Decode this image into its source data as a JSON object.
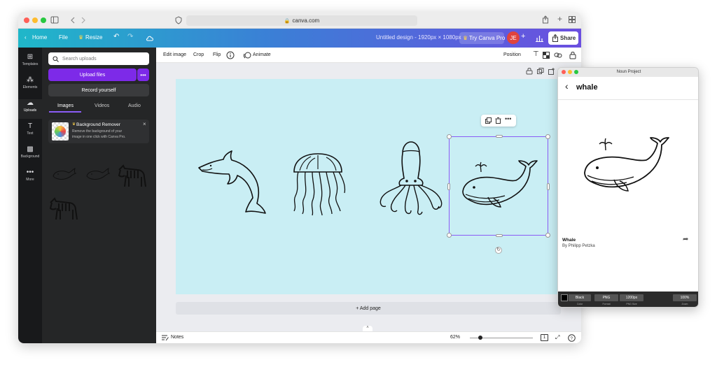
{
  "browser": {
    "address": "canva.com"
  },
  "canva_header": {
    "home": "Home",
    "file": "File",
    "resize": "Resize",
    "design_title": "Untitled design - 1920px × 1080px",
    "try_pro": "Try Canva Pro",
    "avatar": "JE",
    "share": "Share"
  },
  "rail": {
    "items": [
      {
        "label": "Templates",
        "icon": "templates-icon"
      },
      {
        "label": "Elements",
        "icon": "elements-icon"
      },
      {
        "label": "Uploads",
        "icon": "uploads-icon"
      },
      {
        "label": "Text",
        "icon": "text-icon"
      },
      {
        "label": "Background",
        "icon": "background-icon"
      },
      {
        "label": "More",
        "icon": "more-icon"
      }
    ]
  },
  "panel": {
    "search_placeholder": "Search uploads",
    "upload_files": "Upload files",
    "more": "•••",
    "record": "Record yourself",
    "tabs": [
      "Images",
      "Videos",
      "Audio"
    ],
    "bg_remover": {
      "title": "Background Remover",
      "desc1": "Remove the background of your",
      "desc2": "image in one click with Canva Pro."
    }
  },
  "toolbar": {
    "edit_image": "Edit image",
    "crop": "Crop",
    "flip": "Flip",
    "animate": "Animate",
    "position": "Position"
  },
  "canvas": {
    "add_page": "+ Add page"
  },
  "footer": {
    "notes": "Notes",
    "zoom": "62%",
    "page_num": "1",
    "zoom_fraction": 0.62
  },
  "noun_project": {
    "window_title": "Noun Project",
    "search": "whale",
    "icon_name": "Whale",
    "author": "By Philipp Petzka",
    "controls": [
      {
        "value": "Black",
        "caption": "Color"
      },
      {
        "value": "PNG",
        "caption": "Format"
      },
      {
        "value": "1200px",
        "caption": "PNG Size"
      },
      {
        "value": "100%",
        "caption": "Zoom"
      }
    ]
  },
  "colors": {
    "accent": "#7d2ae8",
    "canvas_bg": "#c9eef4",
    "selection": "#8b5cf6"
  }
}
